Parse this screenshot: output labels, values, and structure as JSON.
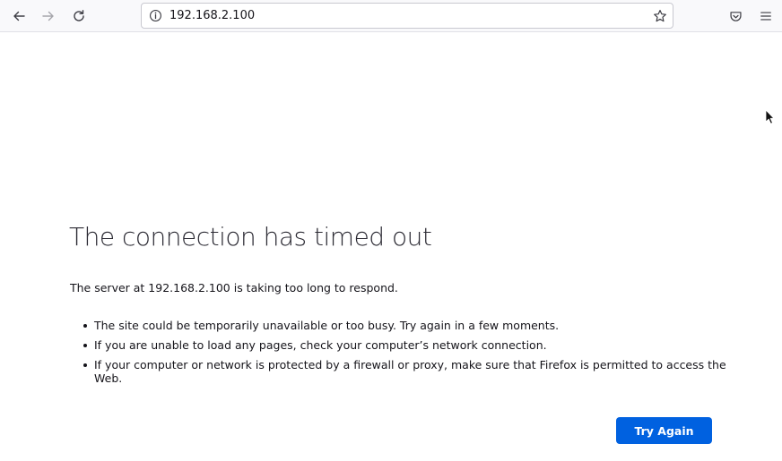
{
  "toolbar": {
    "back_icon": "arrow-left-icon",
    "forward_icon": "arrow-right-icon",
    "reload_icon": "reload-icon",
    "info_icon": "info-icon",
    "bookmark_icon": "star-icon",
    "pocket_icon": "pocket-icon",
    "menu_icon": "hamburger-menu-icon"
  },
  "urlbar": {
    "url": "192.168.2.100"
  },
  "error": {
    "title": "The connection has timed out",
    "description": "The server at 192.168.2.100 is taking too long to respond.",
    "tips": [
      "The site could be temporarily unavailable or too busy. Try again in a few moments.",
      "If you are unable to load any pages, check your computer’s network connection.",
      "If your computer or network is protected by a firewall or proxy, make sure that Firefox is permitted to access the Web."
    ],
    "try_again_label": "Try Again"
  },
  "colors": {
    "accent": "#0061e0",
    "toolbar_bg": "#f9f9fb",
    "text": "#15141a"
  }
}
